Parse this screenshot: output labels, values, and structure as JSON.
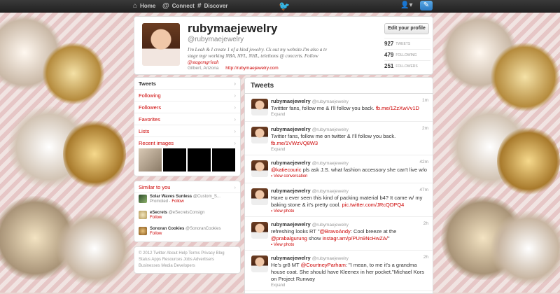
{
  "topbar": {
    "nav": [
      {
        "label": "Home",
        "icon": "home-icon"
      },
      {
        "label": "Connect",
        "icon": "at-icon"
      },
      {
        "label": "Discover",
        "icon": "hash-icon"
      }
    ]
  },
  "profile": {
    "name": "rubymaejewelry",
    "handle": "@rubymaejewelry",
    "bio": "I'm Leah & I create 1 of a kind jewelry. Ck out my website.I'm also a tv stage mgr working NBA, NFL, NHL, telethons @ concerts. Follow",
    "bio_mention": "@stagemgrleah",
    "location": "Gilbert, Arizona",
    "url": "http://rubymaejewelry.com",
    "edit_button": "Edit your profile",
    "stats": [
      {
        "value": "927",
        "label": "TWEETS"
      },
      {
        "value": "479",
        "label": "FOLLOWING"
      },
      {
        "value": "251",
        "label": "FOLLOWERS"
      }
    ]
  },
  "sidebar": {
    "items": [
      {
        "label": "Tweets"
      },
      {
        "label": "Following"
      },
      {
        "label": "Followers"
      },
      {
        "label": "Favorites"
      },
      {
        "label": "Lists"
      },
      {
        "label": "Recent images"
      }
    ]
  },
  "similar": {
    "title": "Similar to you",
    "users": [
      {
        "name": "Solar Waves Sunless",
        "handle": "@Custom_S...",
        "promoted": "Promoted",
        "follow": "Follow"
      },
      {
        "name": "eSecrets",
        "handle": "@eSecretsConsign",
        "follow": "Follow"
      },
      {
        "name": "Sonoran Cookies",
        "handle": "@SonoranCookies",
        "follow": "Follow"
      }
    ]
  },
  "footer": {
    "text": "© 2012 Twitter  About  Help  Terms  Privacy  Blog  Status  Apps  Resources  Jobs  Advertisers  Businesses  Media  Developers"
  },
  "tweets": {
    "title": "Tweets",
    "items": [
      {
        "name": "rubymaejewelry",
        "handle": "@rubymaejewelry",
        "time": "1m",
        "text": "Twittter fans, follow me & I'll follow you back.",
        "link": "fb.me/1ZzXwVv1D",
        "action": "Expand"
      },
      {
        "name": "rubymaejewelry",
        "handle": "@rubymaejewelry",
        "time": "2m",
        "text": "Twitter fans, follow me on twitter & I'll follow you back.",
        "link": "fb.me/1VWzVQ8W3",
        "action": "Expand"
      },
      {
        "name": "rubymaejewelry",
        "handle": "@rubymaejewelry",
        "time": "42m",
        "mention": "@katiecouric",
        "text": "pls ask J.S. what fashion accessory she can't live w/o",
        "action": "View conversation"
      },
      {
        "name": "rubymaejewelry",
        "handle": "@rubymaejewelry",
        "time": "47m",
        "text": "Have u ever seen this kind of packing material b4? It came w/ my baking stone & it's pretty cool.",
        "link": "pic.twitter.com/JRcQDPQ4",
        "action": "View photo"
      },
      {
        "name": "rubymaejewelry",
        "handle": "@rubymaejewelry",
        "time": "2h",
        "text_pre": "refreshing looks RT \"",
        "mention": "@BravoAndy",
        "text": ": Cool breeze at the",
        "mention2": "@prabalgurung",
        "text2": "show",
        "link": "instagr.am/p/PUn9NcHwZA/",
        "text3": "\"",
        "action": "View photo"
      },
      {
        "name": "rubymaejewelry",
        "handle": "@rubymaejewelry",
        "time": "2h",
        "text_pre": "He's gr8 MT",
        "mention": "@CourtneyParham",
        "text": ": \"I mean, to me it's a grandma house coat. She should have Kleenex in her pocket.\"Michael Kors on Project Runway",
        "action": "Expand"
      }
    ]
  }
}
